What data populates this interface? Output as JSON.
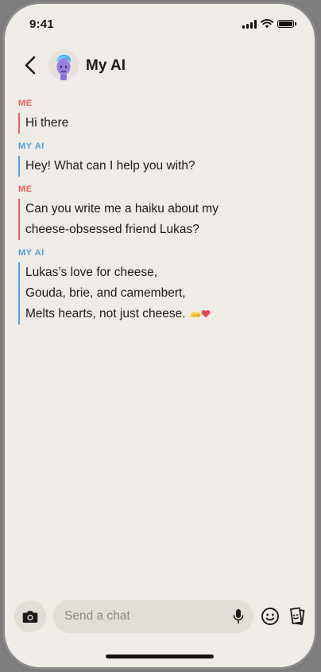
{
  "status_bar": {
    "time": "9:41"
  },
  "header": {
    "title": "My AI",
    "back_icon": "chevron-left-icon",
    "avatar_icon": "bitmoji-avatar"
  },
  "messages": [
    {
      "sender": "ME",
      "role": "me",
      "lines": [
        "Hi there"
      ]
    },
    {
      "sender": "MY AI",
      "role": "ai",
      "lines": [
        "Hey! What can I help you with?"
      ]
    },
    {
      "sender": "ME",
      "role": "me",
      "lines": [
        "Can you write me a haiku about my",
        "cheese-obsessed friend Lukas?"
      ]
    },
    {
      "sender": "MY AI",
      "role": "ai",
      "lines": [
        "Lukas’s love for cheese,",
        "Gouda, brie, and camembert,",
        "Melts hearts, not just cheese."
      ]
    }
  ],
  "emojis": [
    "cheese-emoji",
    "heart-emoji"
  ],
  "composer": {
    "placeholder": "Send a chat",
    "camera_icon": "camera-icon",
    "mic_icon": "microphone-icon",
    "emoji_icon": "smiley-icon",
    "sticker_icon": "sticker-icon"
  },
  "colors": {
    "background": "#efebe6",
    "me_accent": "#ee6060",
    "ai_accent": "#4fa0e8"
  }
}
